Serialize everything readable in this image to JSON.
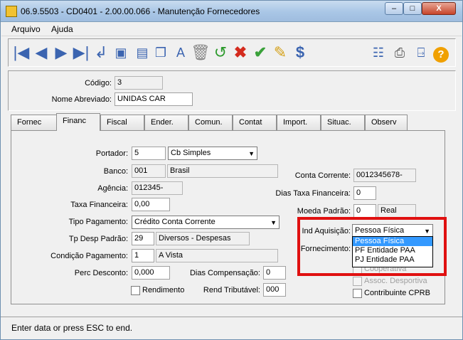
{
  "window": {
    "title": "06.9.5503 - CD0401 - 2.00.00.066 - Manutenção Fornecedores",
    "min": "–",
    "max": "□",
    "close": "X"
  },
  "menu": {
    "arquivo": "Arquivo",
    "ajuda": "Ajuda"
  },
  "toolbar_icons": [
    "first",
    "prev",
    "next",
    "last",
    "enter",
    "zoom",
    "new",
    "copy",
    "edit",
    "delete",
    "undo",
    "cancel",
    "ok",
    "pencil",
    "dollar",
    "tree",
    "print",
    "exit",
    "help"
  ],
  "header": {
    "codigo_label": "Código:",
    "codigo_value": "3",
    "nome_label": "Nome Abreviado:",
    "nome_value": "UNIDAS CAR"
  },
  "tabs": [
    "Fornec",
    "Financ",
    "Fiscal",
    "Ender.",
    "Comun.",
    "Contat",
    "Import.",
    "Situac.",
    "Observ"
  ],
  "financ": {
    "portador_label": "Portador:",
    "portador_value": "5",
    "portador_combo": "Cb Simples",
    "banco_label": "Banco:",
    "banco_code": "001",
    "banco_name": "Brasil",
    "agencia_label": "Agência:",
    "agencia_value": "012345-",
    "taxa_label": "Taxa Financeira:",
    "taxa_value": "0,00",
    "tipo_pag_label": "Tipo Pagamento:",
    "tipo_pag_value": "Crédito Conta Corrente",
    "tp_desp_label": "Tp Desp Padrão:",
    "tp_desp_code": "29",
    "tp_desp_name": "Diversos - Despesas",
    "cond_label": "Condição Pagamento:",
    "cond_code": "1",
    "cond_name": "A Vista",
    "perc_label": "Perc Desconto:",
    "perc_value": "0,000",
    "dias_comp_label": "Dias Compensação:",
    "dias_comp_value": "0",
    "rendimento_label": "Rendimento",
    "rend_trib_label": "Rend Tributável:",
    "rend_trib_value": "000",
    "conta_label": "Conta Corrente:",
    "conta_value": "0012345678-",
    "dias_taxa_label": "Dias Taxa Financeira:",
    "dias_taxa_value": "0",
    "moeda_label": "Moeda Padrão:",
    "moeda_code": "0",
    "moeda_name": "Real",
    "ind_aq_label": "Ind Aquisição:",
    "ind_aq_value": "Pessoa Física",
    "ind_aq_options": [
      "Pessoa Física",
      "PF Entidade PAA",
      "PJ Entidade PAA"
    ],
    "fornecimento_label": "Fornecimento:",
    "cooperativa_label": "Cooperativa",
    "assoc_label": "Assoc. Desportiva",
    "contrib_label": "Contribuinte CPRB"
  },
  "status": "Enter data or press ESC to end."
}
